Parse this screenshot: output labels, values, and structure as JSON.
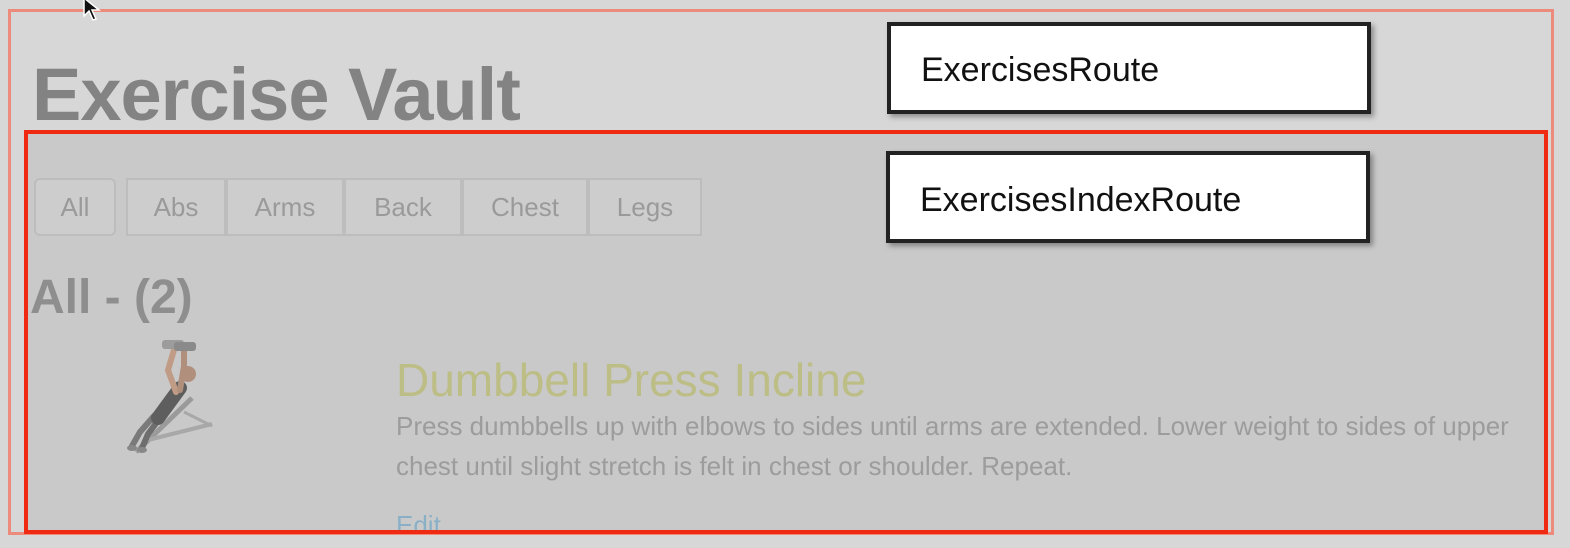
{
  "app": {
    "title": "Exercise Vault"
  },
  "filters": [
    {
      "label": "All"
    },
    {
      "label": "Abs"
    },
    {
      "label": "Arms"
    },
    {
      "label": "Back"
    },
    {
      "label": "Chest"
    },
    {
      "label": "Legs"
    }
  ],
  "section": {
    "heading": "All - (2)"
  },
  "exercises": [
    {
      "title": "Dumbbell Press Incline",
      "description": "Press dumbbells up with elbows to sides until arms are extended. Lower weight to sides of upper chest until slight stretch is felt in chest or shoulder. Repeat.",
      "edit_label": "Edit",
      "image_icon": "incline-dumbbell-press-illustration"
    }
  ],
  "annotations": {
    "outer_route": "ExercisesRoute",
    "inner_route": "ExercisesIndexRoute"
  },
  "colors": {
    "outer_route_border": "#ec8a7b",
    "inner_route_border": "#f02a12",
    "exercise_title": "#bdbd86",
    "edit_link": "#8ab0c8"
  }
}
